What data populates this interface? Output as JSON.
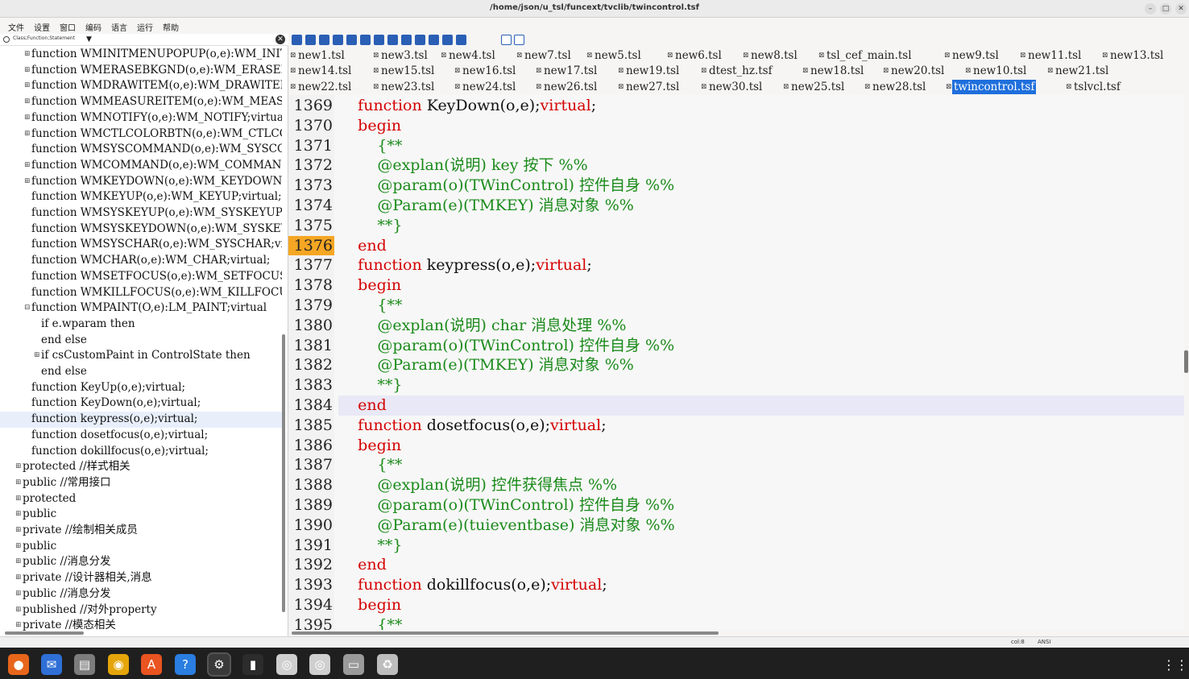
{
  "window": {
    "title": "/home/json/u_tsl/funcext/tvclib/twincontrol.tsf",
    "buttons": [
      "–",
      "□",
      "✕"
    ]
  },
  "menu": [
    "文件",
    "设置",
    "窗口",
    "编码",
    "语言",
    "运行",
    "帮助"
  ],
  "tree_filter": {
    "label": "Class;Function;Statement",
    "icon": "filter-circle-icon"
  },
  "tree": [
    {
      "text": "function WMINITMENUPOPUP(o,e):WM_INITMENUPOPUP",
      "indent": 1,
      "expander": "plus"
    },
    {
      "text": "function WMERASEBKGND(o,e):WM_ERASEBKGND",
      "indent": 1,
      "expander": "plus"
    },
    {
      "text": "function WMDRAWITEM(o,e):WM_DRAWITEM;virtual",
      "indent": 1,
      "expander": "plus"
    },
    {
      "text": "function WMMEASUREITEM(o,e):WM_MEASUREITEM",
      "indent": 1,
      "expander": "plus"
    },
    {
      "text": "function WMNOTIFY(o,e):WM_NOTIFY;virtual",
      "indent": 1,
      "expander": "plus"
    },
    {
      "text": "function WMCTLCOLORBTN(o,e):WM_CTLCOLORBTN",
      "indent": 1,
      "expander": "plus"
    },
    {
      "text": "function WMSYSCOMMAND(o,e):WM_SYSCOMMAND",
      "indent": 1,
      "expander": ""
    },
    {
      "text": "function WMCOMMAND(o,e):WM_COMMAND;virtual",
      "indent": 1,
      "expander": "plus"
    },
    {
      "text": "function WMKEYDOWN(o,e):WM_KEYDOWN;virtual",
      "indent": 1,
      "expander": "plus"
    },
    {
      "text": "function WMKEYUP(o,e):WM_KEYUP;virtual;",
      "indent": 1,
      "expander": ""
    },
    {
      "text": "function WMSYSKEYUP(o,e):WM_SYSKEYUP;virtual",
      "indent": 1,
      "expander": ""
    },
    {
      "text": "function WMSYSKEYDOWN(o,e):WM_SYSKEYDOWN",
      "indent": 1,
      "expander": ""
    },
    {
      "text": "function WMSYSCHAR(o,e):WM_SYSCHAR;virtual",
      "indent": 1,
      "expander": ""
    },
    {
      "text": "function WMCHAR(o,e):WM_CHAR;virtual;",
      "indent": 1,
      "expander": ""
    },
    {
      "text": "function WMSETFOCUS(o,e):WM_SETFOCUS;virtual",
      "indent": 1,
      "expander": ""
    },
    {
      "text": "function WMKILLFOCUS(o,e):WM_KILLFOCUS",
      "indent": 1,
      "expander": ""
    },
    {
      "text": "function WMPAINT(O,e):LM_PAINT;virtual",
      "indent": 1,
      "expander": "minus"
    },
    {
      "text": "if e.wparam then",
      "indent": 2,
      "expander": ""
    },
    {
      "text": "end else",
      "indent": 2,
      "expander": ""
    },
    {
      "text": "if csCustomPaint in ControlState then",
      "indent": 2,
      "expander": "plus"
    },
    {
      "text": "end else",
      "indent": 2,
      "expander": ""
    },
    {
      "text": "function KeyUp(o,e);virtual;",
      "indent": 1,
      "expander": ""
    },
    {
      "text": "function KeyDown(o,e);virtual;",
      "indent": 1,
      "expander": ""
    },
    {
      "text": "function keypress(o,e);virtual;",
      "indent": 1,
      "expander": "",
      "selected": true
    },
    {
      "text": "function dosetfocus(o,e);virtual;",
      "indent": 1,
      "expander": ""
    },
    {
      "text": "function dokillfocus(o,e);virtual;",
      "indent": 1,
      "expander": ""
    },
    {
      "text": "protected //样式相关",
      "indent": 0,
      "expander": "plus"
    },
    {
      "text": "public //常用接口",
      "indent": 0,
      "expander": "plus"
    },
    {
      "text": "protected",
      "indent": 0,
      "expander": "plus"
    },
    {
      "text": "public",
      "indent": 0,
      "expander": "plus"
    },
    {
      "text": "private //绘制相关成员",
      "indent": 0,
      "expander": "plus"
    },
    {
      "text": "public",
      "indent": 0,
      "expander": "plus"
    },
    {
      "text": "public //消息分发",
      "indent": 0,
      "expander": "plus"
    },
    {
      "text": "private //设计器相关,消息",
      "indent": 0,
      "expander": "plus"
    },
    {
      "text": "public //消息分发",
      "indent": 0,
      "expander": "plus"
    },
    {
      "text": "published //对外property",
      "indent": 0,
      "expander": "plus"
    },
    {
      "text": "private //模态相关",
      "indent": 0,
      "expander": "plus"
    }
  ],
  "toolbar_icons": [
    "new-file-icon",
    "save-icon",
    "save-all-icon",
    "copy-icon",
    "paste-icon",
    "undo-icon",
    "redo-icon",
    "find-icon",
    "search-icon",
    "back-icon",
    "forward-icon",
    "list-icon",
    "locate-icon",
    "window-icon",
    "run-icon"
  ],
  "tabs_row1": [
    "new1.tsl",
    "new3.tsl",
    "new4.tsl",
    "new7.tsl",
    "new5.tsl",
    "new6.tsl",
    "new8.tsl",
    "tsl_cef_main.tsl",
    "new9.tsl",
    "new11.tsl",
    "new13.tsl"
  ],
  "tabs_row2": [
    "new14.tsl",
    "new15.tsl",
    "new16.tsl",
    "new17.tsl",
    "new19.tsl",
    "dtest_hz.tsf",
    "new18.tsl",
    "new20.tsl",
    "new10.tsl",
    "new21.tsl"
  ],
  "tabs_row3": [
    "new22.tsl",
    "new23.tsl",
    "new24.tsl",
    "new26.tsl",
    "new27.tsl",
    "new30.tsl",
    "new25.tsl",
    "new28.tsl",
    "twincontrol.tsf",
    "tslvcl.tsf"
  ],
  "active_tab": "twincontrol.tsf",
  "code": [
    {
      "n": "1369",
      "parts": [
        [
          "    ",
          ""
        ],
        [
          "function",
          "kw"
        ],
        [
          " KeyDown(o,e);",
          ""
        ],
        [
          "virtual",
          "kw"
        ],
        [
          ";",
          ""
        ]
      ]
    },
    {
      "n": "1370",
      "parts": [
        [
          "    ",
          ""
        ],
        [
          "begin",
          "kw"
        ]
      ]
    },
    {
      "n": "1371",
      "parts": [
        [
          "        ",
          ""
        ],
        [
          "{**",
          "cm"
        ]
      ]
    },
    {
      "n": "1372",
      "parts": [
        [
          "        ",
          ""
        ],
        [
          "@explan(说明) key 按下 %%",
          "cm"
        ]
      ]
    },
    {
      "n": "1373",
      "parts": [
        [
          "        ",
          ""
        ],
        [
          "@param(o)(TWinControl) 控件自身 %%",
          "cm"
        ]
      ]
    },
    {
      "n": "1374",
      "parts": [
        [
          "        ",
          ""
        ],
        [
          "@Param(e)(TMKEY) 消息对象 %%",
          "cm"
        ]
      ]
    },
    {
      "n": "1375",
      "parts": [
        [
          "        ",
          ""
        ],
        [
          "**}",
          "cm"
        ]
      ]
    },
    {
      "n": "1376",
      "parts": [
        [
          "    ",
          ""
        ],
        [
          "end",
          "kw"
        ]
      ],
      "breakpoint": true
    },
    {
      "n": "1377",
      "parts": [
        [
          "    ",
          ""
        ],
        [
          "function",
          "kw"
        ],
        [
          " keypress(o,e);",
          ""
        ],
        [
          "virtual",
          "kw"
        ],
        [
          ";",
          ""
        ]
      ]
    },
    {
      "n": "1378",
      "parts": [
        [
          "    ",
          ""
        ],
        [
          "begin",
          "kw"
        ]
      ]
    },
    {
      "n": "1379",
      "parts": [
        [
          "        ",
          ""
        ],
        [
          "{**",
          "cm"
        ]
      ]
    },
    {
      "n": "1380",
      "parts": [
        [
          "        ",
          ""
        ],
        [
          "@explan(说明) char 消息处理 %%",
          "cm"
        ]
      ]
    },
    {
      "n": "1381",
      "parts": [
        [
          "        ",
          ""
        ],
        [
          "@param(o)(TWinControl) 控件自身 %%",
          "cm"
        ]
      ]
    },
    {
      "n": "1382",
      "parts": [
        [
          "        ",
          ""
        ],
        [
          "@Param(e)(TMKEY) 消息对象 %%",
          "cm"
        ]
      ]
    },
    {
      "n": "1383",
      "parts": [
        [
          "        ",
          ""
        ],
        [
          "**}",
          "cm"
        ]
      ]
    },
    {
      "n": "1384",
      "parts": [
        [
          "    ",
          ""
        ],
        [
          "end",
          "kw"
        ]
      ],
      "current": true
    },
    {
      "n": "1385",
      "parts": [
        [
          "    ",
          ""
        ],
        [
          "function",
          "kw"
        ],
        [
          " dosetfocus(o,e);",
          ""
        ],
        [
          "virtual",
          "kw"
        ],
        [
          ";",
          ""
        ]
      ]
    },
    {
      "n": "1386",
      "parts": [
        [
          "    ",
          ""
        ],
        [
          "begin",
          "kw"
        ]
      ]
    },
    {
      "n": "1387",
      "parts": [
        [
          "        ",
          ""
        ],
        [
          "{**",
          "cm"
        ]
      ]
    },
    {
      "n": "1388",
      "parts": [
        [
          "        ",
          ""
        ],
        [
          "@explan(说明) 控件获得焦点 %%",
          "cm"
        ]
      ]
    },
    {
      "n": "1389",
      "parts": [
        [
          "        ",
          ""
        ],
        [
          "@param(o)(TWinControl) 控件自身 %%",
          "cm"
        ]
      ]
    },
    {
      "n": "1390",
      "parts": [
        [
          "        ",
          ""
        ],
        [
          "@Param(e)(tuieventbase) 消息对象 %%",
          "cm"
        ]
      ]
    },
    {
      "n": "1391",
      "parts": [
        [
          "        ",
          ""
        ],
        [
          "**}",
          "cm"
        ]
      ]
    },
    {
      "n": "1392",
      "parts": [
        [
          "    ",
          ""
        ],
        [
          "end",
          "kw"
        ]
      ]
    },
    {
      "n": "1393",
      "parts": [
        [
          "    ",
          ""
        ],
        [
          "function",
          "kw"
        ],
        [
          " dokillfocus(o,e);",
          ""
        ],
        [
          "virtual",
          "kw"
        ],
        [
          ";",
          ""
        ]
      ]
    },
    {
      "n": "1394",
      "parts": [
        [
          "    ",
          ""
        ],
        [
          "begin",
          "kw"
        ]
      ]
    },
    {
      "n": "1395",
      "parts": [
        [
          "        ",
          ""
        ],
        [
          "{**",
          "cm"
        ]
      ]
    }
  ],
  "status": {
    "position": "col:8",
    "encoding": "ANSI"
  },
  "dock": [
    {
      "icon": "firefox-icon",
      "glyph": "●",
      "color": "#e8661b"
    },
    {
      "icon": "thunderbird-icon",
      "glyph": "✉",
      "color": "#2f6fd6"
    },
    {
      "icon": "files-icon",
      "glyph": "▤",
      "color": "#7c7c7c"
    },
    {
      "icon": "rhythmbox-icon",
      "glyph": "◉",
      "color": "#e5a50a"
    },
    {
      "icon": "software-icon",
      "glyph": "A",
      "color": "#e95420"
    },
    {
      "icon": "help-icon",
      "glyph": "?",
      "color": "#2a7de1"
    },
    {
      "icon": "settings-icon",
      "glyph": "⚙",
      "color": "#6d6d6d"
    },
    {
      "icon": "terminal-icon",
      "glyph": "▮",
      "color": "#2c2c2c"
    },
    {
      "icon": "disc-icon",
      "glyph": "◎",
      "color": "#cfcfcf"
    },
    {
      "icon": "disc-icon-2",
      "glyph": "◎",
      "color": "#cfcfcf"
    },
    {
      "icon": "save-drive-icon",
      "glyph": "▭",
      "color": "#9a9a9a"
    },
    {
      "icon": "trash-icon",
      "glyph": "♻",
      "color": "#bdbdbd"
    }
  ],
  "colors": {
    "keyword": "#d40000",
    "comment": "#1a8a1a",
    "active_tab": "#1f6fdc",
    "breakpoint": "#f5a623"
  }
}
